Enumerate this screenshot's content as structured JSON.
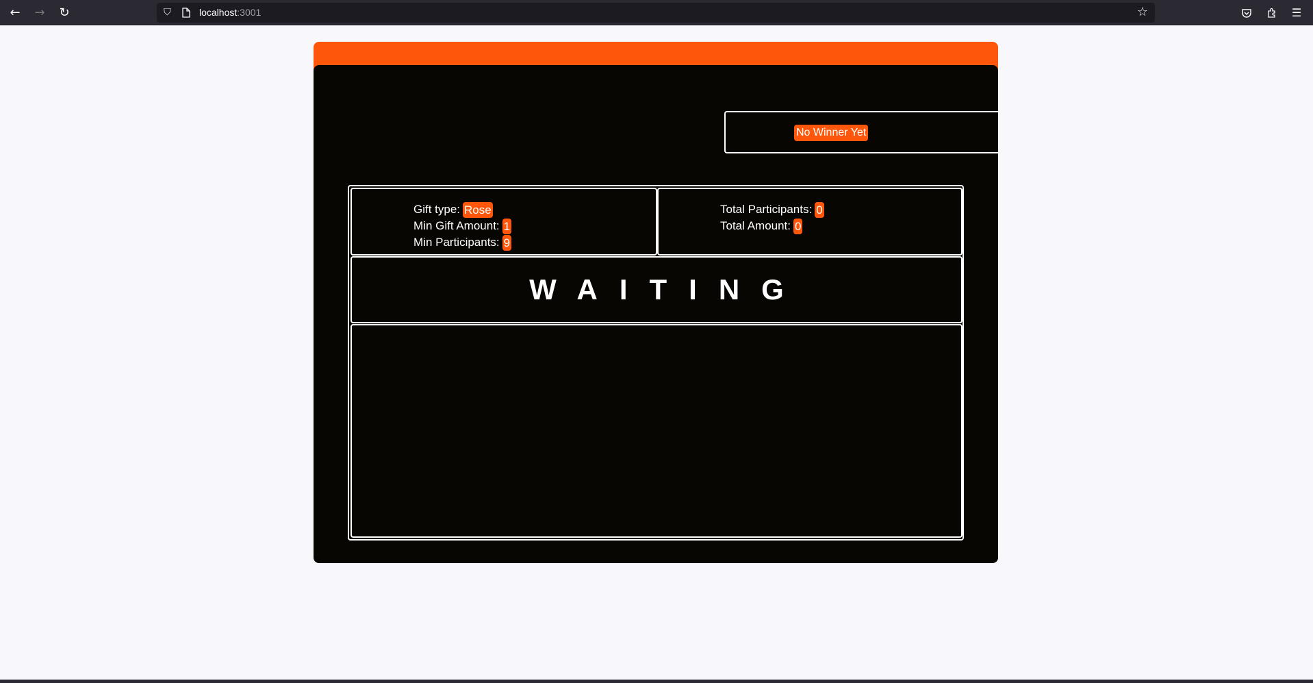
{
  "browser": {
    "url_host": "localhost",
    "url_port": ":3001"
  },
  "icons": {
    "back": "arrow-left-icon",
    "forward": "arrow-right-icon",
    "reload": "reload-icon",
    "shield": "shield-icon",
    "page": "page-icon",
    "bookmark": "star-icon",
    "pocket": "pocket-icon",
    "extensions": "puzzle-icon",
    "menu": "hamburger-menu-icon"
  },
  "colors": {
    "accent": "#fe570b",
    "card_bg": "#080602",
    "page_bg": "#f8f8fc"
  },
  "winner": {
    "label": "No Winner Yet"
  },
  "settings": {
    "gift_type_label": "Gift type:",
    "gift_type_value": "Rose",
    "min_gift_label": "Min Gift Amount:",
    "min_gift_value": "1",
    "min_participants_label": "Min Participants:",
    "min_participants_value": "9"
  },
  "stats": {
    "total_participants_label": "Total Participants:",
    "total_participants_value": "0",
    "total_amount_label": "Total Amount:",
    "total_amount_value": "0"
  },
  "status": {
    "text": "WAITING"
  }
}
